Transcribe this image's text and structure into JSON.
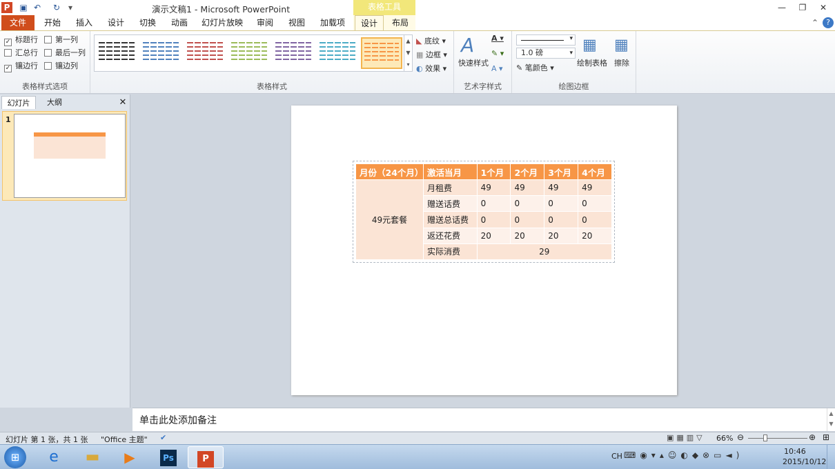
{
  "window": {
    "title": "演示文稿1 - Microsoft PowerPoint",
    "context_header": "表格工具"
  },
  "tabs": [
    "文件",
    "开始",
    "插入",
    "设计",
    "切换",
    "动画",
    "幻灯片放映",
    "审阅",
    "视图",
    "加载项",
    "设计",
    "布局"
  ],
  "ribbon": {
    "options_group": {
      "label": "表格样式选项",
      "items": [
        {
          "label": "标题行",
          "checked": true
        },
        {
          "label": "第一列",
          "checked": false
        },
        {
          "label": "汇总行",
          "checked": false
        },
        {
          "label": "最后一列",
          "checked": false
        },
        {
          "label": "镶边行",
          "checked": true
        },
        {
          "label": "镶边列",
          "checked": false
        }
      ]
    },
    "styles_group": {
      "label": "表格样式",
      "shading": "底纹",
      "border": "边框",
      "effects": "效果",
      "swatch_colors": [
        "#333333",
        "#4f81bd",
        "#c0504d",
        "#9bbb59",
        "#8064a2",
        "#4bacc6",
        "#f79646"
      ]
    },
    "wordart_group": {
      "label": "艺术字样式",
      "quick_styles": "快速样式"
    },
    "draw_group": {
      "label": "绘图边框",
      "pen_weight": "1.0 磅",
      "pen_color": "笔颜色",
      "draw_table": "绘制表格",
      "eraser": "擦除"
    }
  },
  "left_pane": {
    "tab_slides": "幻灯片",
    "tab_outline": "大纲",
    "slide_number": "1"
  },
  "table": {
    "headers": [
      "月份（24个月）",
      "激活当月",
      "1个月",
      "2个月",
      "3个月",
      "4个月"
    ],
    "merged_label": "49元套餐",
    "rows": [
      {
        "name": "月租费",
        "values": [
          "49",
          "49",
          "49",
          "49"
        ]
      },
      {
        "name": "赠送话费",
        "values": [
          "0",
          "0",
          "0",
          "0"
        ]
      },
      {
        "name": "赠送总话费",
        "values": [
          "0",
          "0",
          "0",
          "0"
        ]
      },
      {
        "name": "返还花费",
        "values": [
          "20",
          "20",
          "20",
          "20"
        ]
      }
    ],
    "last_row": {
      "name": "实际消费",
      "value": "29"
    }
  },
  "notes_placeholder": "单击此处添加备注",
  "status": {
    "slide_info": "幻灯片 第 1 张，共 1 张",
    "theme": "\"Office 主题\"",
    "zoom": "66%"
  },
  "taskbar": {
    "lang": "CH",
    "time": "10:46",
    "date": "2015/10/12"
  }
}
